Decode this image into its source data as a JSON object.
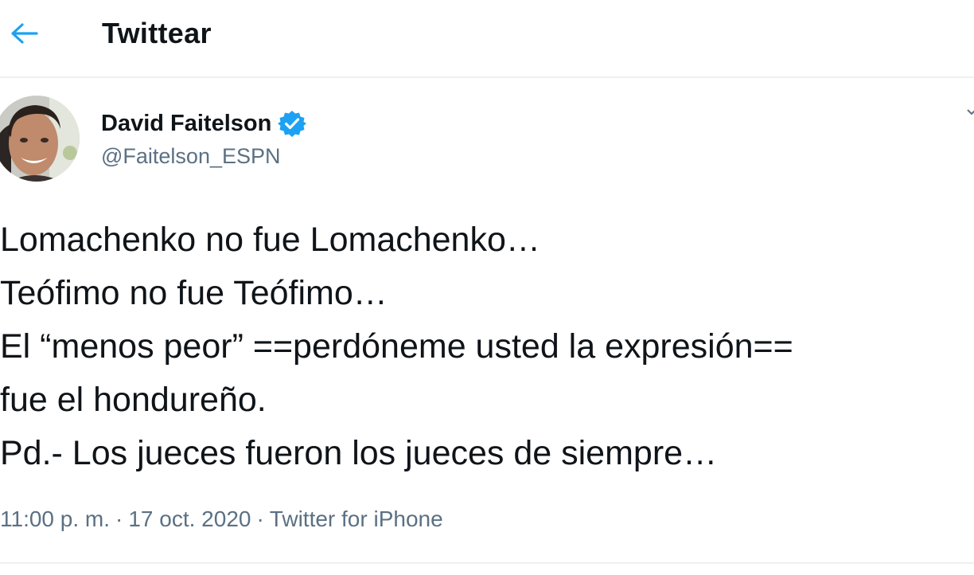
{
  "header": {
    "title": "Twittear",
    "back_icon": "arrow-left-icon"
  },
  "colors": {
    "accent": "#1da1f2",
    "text": "#0f1419",
    "secondary": "#5b7083",
    "divider": "#eef0f1"
  },
  "tweet": {
    "author": {
      "name": "David Faitelson",
      "handle": "@Faitelson_ESPN",
      "verified_icon": "verified-badge-icon",
      "avatar_icon": "avatar-photo"
    },
    "lines": [
      "Lomachenko no fue Lomachenko…",
      "Teófimo no fue Teófimo…",
      "El “menos peor” ==perdóneme usted la expresión==",
      "fue el hondureño.",
      "Pd.- Los jueces fueron los jueces de siempre…"
    ],
    "time": "11:00 p. m.",
    "separator": "·",
    "date": "17 oct. 2020",
    "source": "Twitter for iPhone"
  }
}
